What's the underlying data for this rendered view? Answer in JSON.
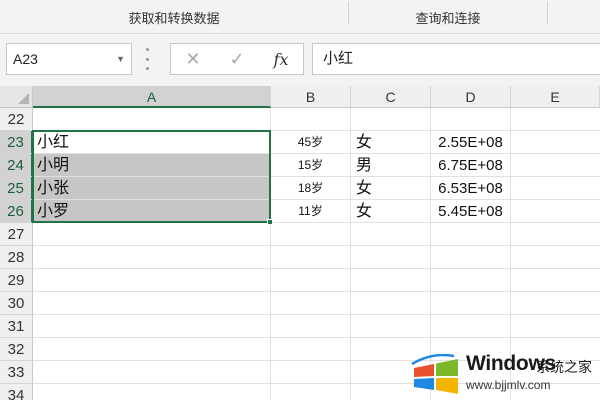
{
  "ribbon": {
    "group_get_transform": "获取和转换数据",
    "group_queries_connections": "查询和连接"
  },
  "formula_bar": {
    "name_box": "A23",
    "cancel_icon": "✕",
    "enter_icon": "✓",
    "function_icon": "fx",
    "value": "小红"
  },
  "columns": [
    "A",
    "B",
    "C",
    "D",
    "E"
  ],
  "selected_column": "A",
  "rows": [
    {
      "num": "22",
      "name": "",
      "age": "",
      "gender": "",
      "value": ""
    },
    {
      "num": "23",
      "name": "小红",
      "age": "45岁",
      "gender": "女",
      "value": "2.55E+08"
    },
    {
      "num": "24",
      "name": "小明",
      "age": "15岁",
      "gender": "男",
      "value": "6.75E+08"
    },
    {
      "num": "25",
      "name": "小张",
      "age": "18岁",
      "gender": "女",
      "value": "6.53E+08"
    },
    {
      "num": "26",
      "name": "小罗",
      "age": "11岁",
      "gender": "女",
      "value": "5.45E+08"
    },
    {
      "num": "27",
      "name": "",
      "age": "",
      "gender": "",
      "value": ""
    },
    {
      "num": "28",
      "name": "",
      "age": "",
      "gender": "",
      "value": ""
    },
    {
      "num": "29",
      "name": "",
      "age": "",
      "gender": "",
      "value": ""
    },
    {
      "num": "30",
      "name": "",
      "age": "",
      "gender": "",
      "value": ""
    },
    {
      "num": "31",
      "name": "",
      "age": "",
      "gender": "",
      "value": ""
    },
    {
      "num": "32",
      "name": "",
      "age": "",
      "gender": "",
      "value": ""
    },
    {
      "num": "33",
      "name": "",
      "age": "",
      "gender": "",
      "value": ""
    },
    {
      "num": "34",
      "name": "",
      "age": "",
      "gender": "",
      "value": ""
    }
  ],
  "selection": {
    "active_cell": "A23",
    "range": "A23:A26"
  },
  "watermark": {
    "title": "Windows",
    "subtitle": "系统之家",
    "url": "www.bjjmlv.com",
    "logo_icon": "windows-logo-icon",
    "colors": {
      "logo_red": "#e8502f",
      "logo_green": "#7cb829",
      "logo_blue": "#1e88e5",
      "logo_yellow": "#f5b400"
    }
  },
  "colors": {
    "accent": "#217346",
    "selection_fill": "#c6c6c6",
    "header_bg": "#efefef"
  }
}
